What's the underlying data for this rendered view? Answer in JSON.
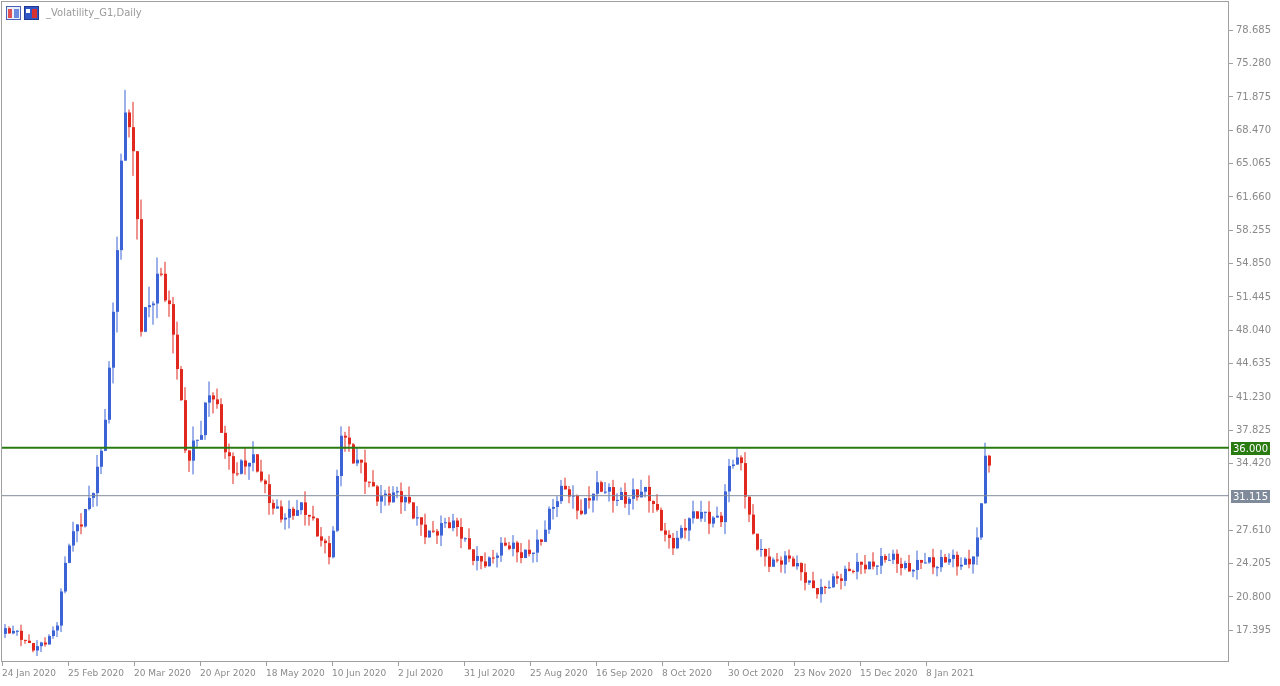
{
  "chart": {
    "title": "_Volatility_G1,Daily",
    "price_axis": [
      "78.685",
      "75.280",
      "71.875",
      "68.470",
      "65.065",
      "61.660",
      "58.255",
      "54.850",
      "51.445",
      "48.040",
      "44.635",
      "41.230",
      "37.825",
      "34.420",
      "27.610",
      "24.205",
      "20.800",
      "17.395"
    ],
    "time_axis": [
      "24 Jan 2020",
      "25 Feb 2020",
      "20 Mar 2020",
      "20 Apr 2020",
      "18 May 2020",
      "10 Jun 2020",
      "2 Jul 2020",
      "31 Jul 2020",
      "25 Aug 2020",
      "16 Sep 2020",
      "8 Oct 2020",
      "30 Oct 2020",
      "23 Nov 2020",
      "15 Dec 2020",
      "8 Jan 2021"
    ],
    "price_lines": [
      {
        "label": "36.000",
        "color": "#2a7a12"
      },
      {
        "label": "31.115",
        "color": "#7f8a9a"
      }
    ]
  }
}
